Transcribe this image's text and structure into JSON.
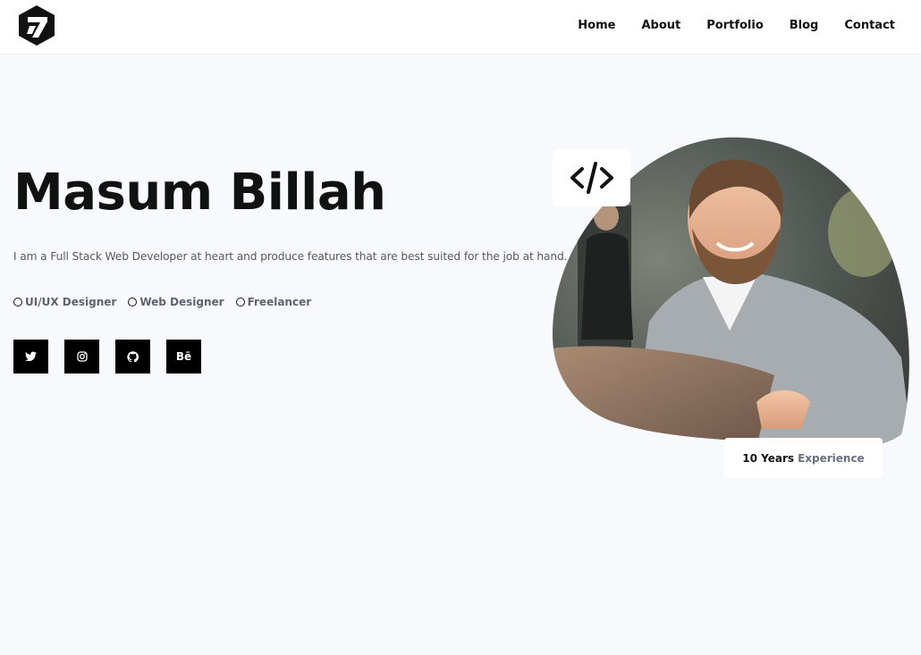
{
  "nav": {
    "logo_icon": "brand-logo-icon",
    "links": [
      "Home",
      "About",
      "Portfolio",
      "Blog",
      "Contact"
    ]
  },
  "hero": {
    "name": "Masum Billah",
    "description": "I am a Full Stack Web Developer at heart and produce features that are best suited for the job at hand.",
    "roles": [
      "UI/UX Designer",
      "Web Designer",
      "Freelancer"
    ],
    "socials": [
      {
        "icon": "twitter-icon"
      },
      {
        "icon": "instagram-icon"
      },
      {
        "icon": "github-icon"
      },
      {
        "icon": "behance-icon",
        "text": "Bē"
      }
    ]
  },
  "visual": {
    "code_badge_icon": "code-icon",
    "experience": {
      "years": "10 Years",
      "label": "Experience"
    }
  },
  "colors": {
    "page_bg": "#f8f9fc",
    "nav_bg": "#ffffff",
    "text_primary": "#111111",
    "text_muted": "#55595f",
    "social_bg": "#000000"
  }
}
